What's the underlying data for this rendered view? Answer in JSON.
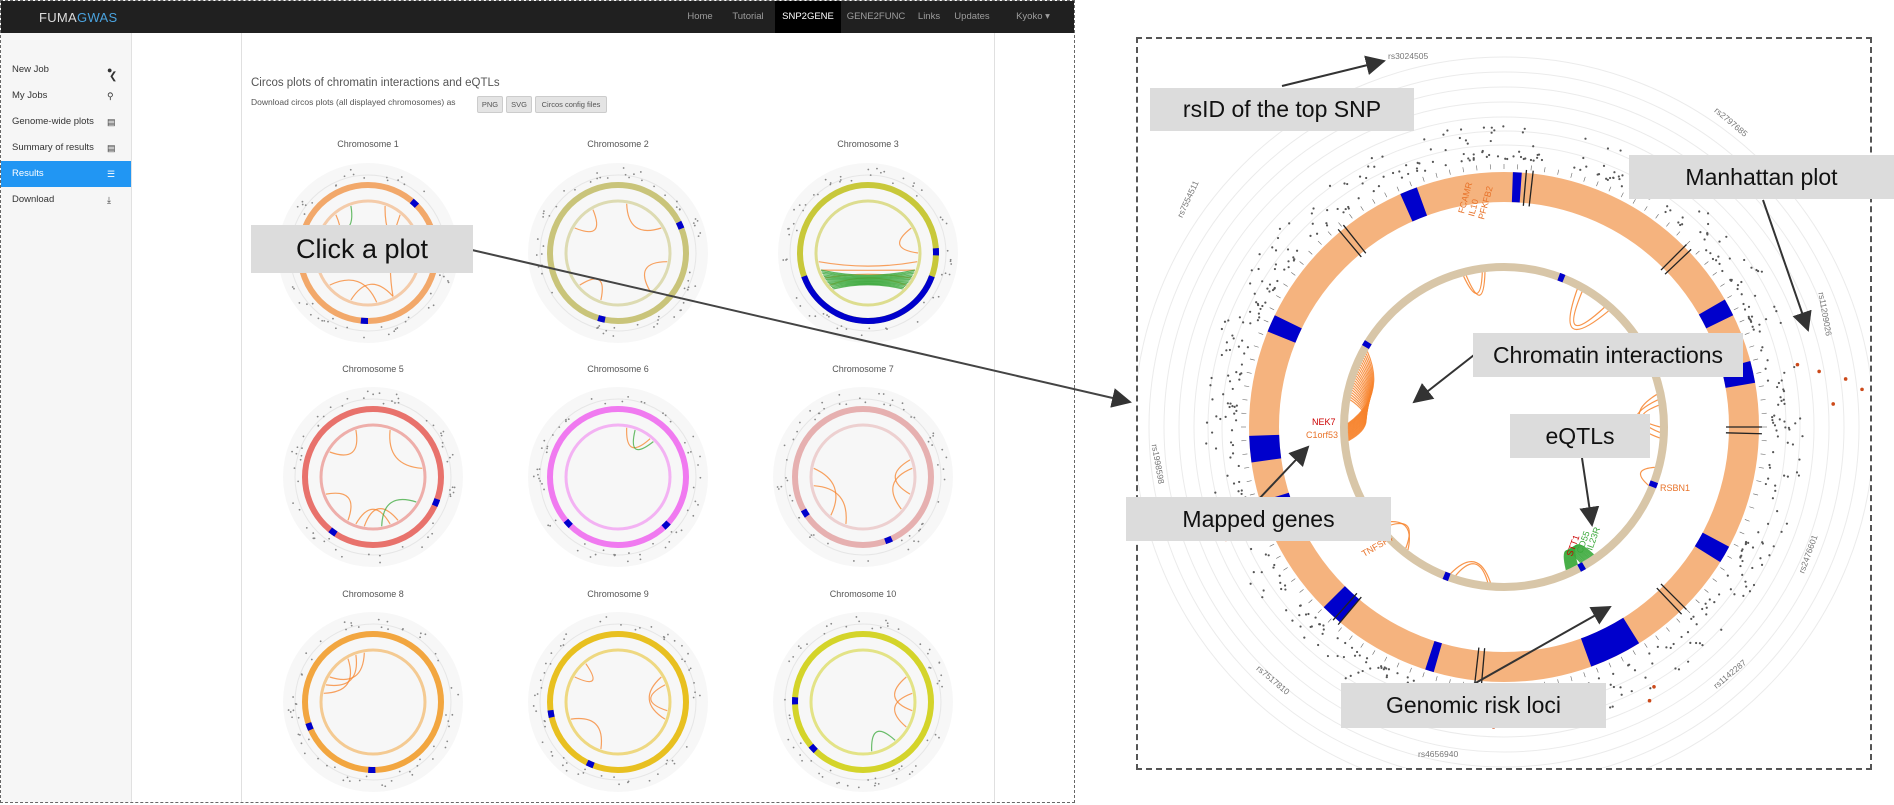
{
  "app": {
    "logo_part1": "FUMA",
    "logo_part2": "GWAS",
    "nav": [
      "Home",
      "Tutorial",
      "SNP2GENE",
      "GENE2FUNC",
      "Links",
      "Updates",
      "Kyoko ▾"
    ],
    "active_nav": "SNP2GENE"
  },
  "sidebar": {
    "collapse_icon": "chevron-left-icon",
    "items": [
      {
        "label": "New Job",
        "icon": "user-icon"
      },
      {
        "label": "My Jobs",
        "icon": "search-icon"
      },
      {
        "label": "Genome-wide plots",
        "icon": "bar-chart-icon"
      },
      {
        "label": "Summary of results",
        "icon": "bar-chart-icon"
      },
      {
        "label": "Results",
        "icon": "list-icon"
      },
      {
        "label": "Download",
        "icon": "download-icon"
      }
    ],
    "active_item": "Results"
  },
  "main": {
    "title": "Circos plots of chromatin interactions and eQTLs",
    "download_text": "Download circos plots (all displayed chromosomes) as",
    "buttons": [
      "PNG",
      "SVG",
      "Circos config files"
    ],
    "chromosomes": [
      "Chromosome 1",
      "Chromosome 2",
      "Chromosome 3",
      "Chromosome 5",
      "Chromosome 6",
      "Chromosome 7",
      "Chromosome 8",
      "Chromosome 9",
      "Chromosome 10"
    ],
    "ring_colors": [
      "#f2a86a",
      "#c9c47a",
      "#c8c83a",
      "#e8726c",
      "#f07af0",
      "#e6b0b0",
      "#f2a640",
      "#e8c020",
      "#d4d42a"
    ]
  },
  "callouts": {
    "click": "Click a plot",
    "rsid": "rsID of the top SNP",
    "manhattan": "Manhattan plot",
    "chromatin": "Chromatin interactions",
    "eqtls": "eQTLs",
    "mapped": "Mapped genes",
    "risk": "Genomic risk loci"
  },
  "detail": {
    "snp_labels": [
      "rs3024505",
      "rs2797685",
      "rs11209026",
      "rs2476601",
      "rs1142287",
      "rs4656940",
      "rs7517810",
      "rs1998598",
      "rs7554511"
    ],
    "genes_left": [
      "NEK7",
      "C1orf53"
    ],
    "genes_top": [
      "FCAMR",
      "IL10",
      "PFKFB2"
    ],
    "genes_bottom_left": "TNFSF4",
    "genes_right": "RSBN1",
    "genes_eqtl": [
      "IL23R",
      "CD55",
      "STT1"
    ],
    "colors": {
      "outer_ring": "#f5b37e",
      "inner_ring": "#d8c6a8",
      "loci": "#0000cc",
      "chromatin": "#f7832b",
      "eqtl": "#3aa83a"
    }
  }
}
